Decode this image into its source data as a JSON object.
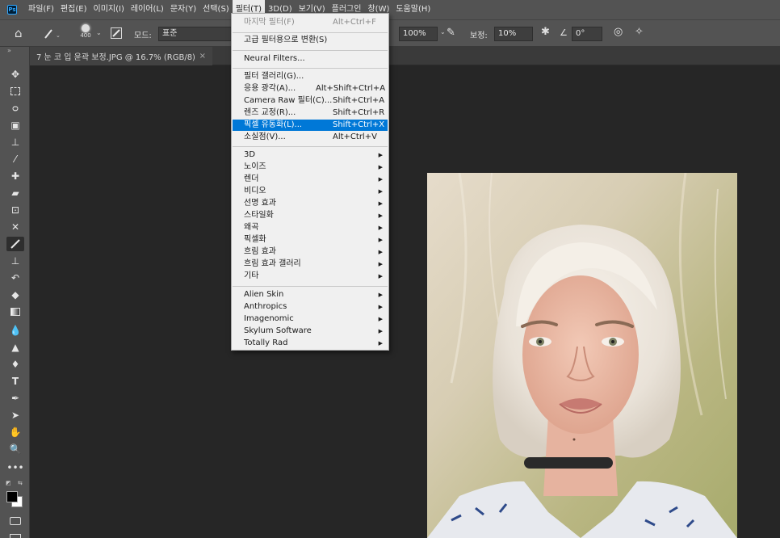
{
  "app": {
    "logo_text": "Ps"
  },
  "menubar": {
    "items": [
      "파일(F)",
      "편집(E)",
      "이미지(I)",
      "레이어(L)",
      "문자(Y)",
      "선택(S)",
      "필터(T)",
      "3D(D)",
      "보기(V)",
      "플러그인",
      "창(W)",
      "도움말(H)"
    ],
    "open_index": 6
  },
  "options": {
    "brush_size": "400",
    "mode_label": "모드:",
    "mode_value": "표준",
    "opacity_value": "100%",
    "smoothing_label": "보정:",
    "smoothing_value": "10%",
    "angle_value": "0°"
  },
  "tab": {
    "title": "7 눈 코 입 윤곽 보정.JPG @ 16.7% (RGB/8)",
    "close": "×"
  },
  "toolbar": {
    "tools": [
      "move",
      "marquee",
      "lasso",
      "object-select",
      "crop",
      "eyedropper",
      "healing",
      "brush",
      "clone-stamp",
      "history-brush",
      "eraser",
      "gradient",
      "blur",
      "dodge",
      "pen",
      "type",
      "path-select",
      "shape",
      "hand",
      "zoom",
      "more"
    ]
  },
  "filter_menu": {
    "last_filter": {
      "label": "마지막 필터(F)",
      "shortcut": "Alt+Ctrl+F"
    },
    "convert_smart": {
      "label": "고급 필터용으로 변환(S)"
    },
    "neural": {
      "label": "Neural Filters..."
    },
    "gallery": {
      "label": "필터 갤러리(G)..."
    },
    "adaptive_wide": {
      "label": "응용 광각(A)...",
      "shortcut": "Alt+Shift+Ctrl+A"
    },
    "camera_raw": {
      "label": "Camera Raw 필터(C)...",
      "shortcut": "Shift+Ctrl+A"
    },
    "lens_correction": {
      "label": "렌즈 교정(R)...",
      "shortcut": "Shift+Ctrl+R"
    },
    "liquify": {
      "label": "픽셀 유동화(L)...",
      "shortcut": "Shift+Ctrl+X"
    },
    "vanishing_point": {
      "label": "소실점(V)...",
      "shortcut": "Alt+Ctrl+V"
    },
    "submenus": [
      "3D",
      "노이즈",
      "렌더",
      "비디오",
      "선명 효과",
      "스타일화",
      "왜곡",
      "픽셀화",
      "흐림 효과",
      "흐림 효과 갤러리",
      "기타"
    ],
    "plugins": [
      "Alien Skin",
      "Anthropics",
      "Imagenomic",
      "Skylum Software",
      "Totally Rad"
    ]
  },
  "colors": {
    "accent": "#0078d7",
    "ui_bg": "#535353",
    "canvas_bg": "#262626"
  }
}
